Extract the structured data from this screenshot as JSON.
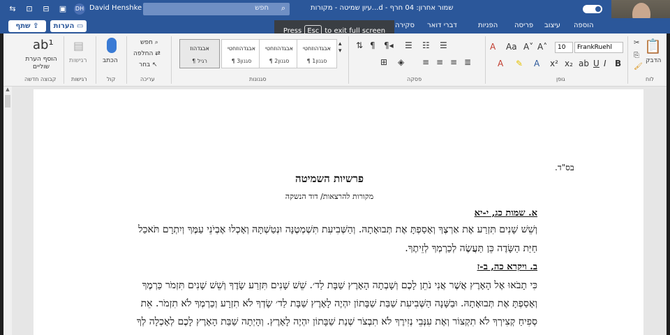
{
  "titlebar": {
    "user_initials": "DH",
    "user_name": "David Henshke",
    "search_placeholder": "חפש",
    "doc_title": "עיון שמיטה - מקורות...d - שמור אחרון: 04 חרף",
    "icon_labels": [
      "⇆",
      "⊡",
      "⊟",
      "▣"
    ]
  },
  "fullscreen": {
    "press": "Press",
    "esc": "Esc",
    "rest": "to exit full screen"
  },
  "tabs": [
    "הוספה",
    "עיצוב",
    "פריסה",
    "הפניות",
    "דברי דואר",
    "סקירה"
  ],
  "share_label": "שתף",
  "comments_label": "הערות",
  "ribbon": {
    "clipboard": {
      "paste": "הדבק",
      "group": "לוח"
    },
    "font": {
      "size": "10",
      "name": "FrankRuehl",
      "group": "גופן"
    },
    "paragraph": {
      "group": "פסקה"
    },
    "styles": {
      "group": "סגנונות",
      "items": [
        {
          "name": "אבגדהוז",
          "caption": "¶ רגיל"
        },
        {
          "name": "אבגדהוזחטי",
          "caption": "¶ סגנון3"
        },
        {
          "name": "אבגדהוזחטי",
          "caption": "¶ סגנון2"
        },
        {
          "name": "אבגדהוזחטי",
          "caption": "¶ סגנון1"
        }
      ]
    },
    "editing": {
      "find": "חפש",
      "replace": "החלפה",
      "select": "בחר",
      "group": "עריכה"
    },
    "voice": {
      "dictate": "הכתב",
      "group": "קול"
    },
    "sensitivity": {
      "label": "רגישות",
      "group": "רגישות"
    },
    "comments_group": {
      "label": "הוסף הערת שוליים",
      "group": "קבוצה חדשה"
    }
  },
  "document": {
    "page_header": "בס\"ד.",
    "title": "פרשיות השמיטה",
    "subtitle": "מקורות להרצאות/ דוד הנשקה",
    "sections": [
      {
        "head": "א. שמות כג, י-יא"
      },
      {
        "head": "ב. ויקרא כה, ב-ז"
      }
    ],
    "lines": [
      "וְשֵׁשׁ שָׁנִים תִּזְרַע אֶת אַרְצֶךָ וְאָסַפְתָּ אֶת תְּבוּאָתָהּ. וְהַשְּׁבִיעִת תִּשְׁמְטֶנָּה וּנְטַשְׁתָּהּ וְאָכְלוּ אֶבְיֹנֵי עַמֶּךָ וְיִתְרָם תֹּאכַל",
      "חַיַּת הַשָּׂדֶה כֵּן תַּעֲשֶׂה לְכַרְמְךָ לְזֵיתֶךָ.",
      "כִּי תָבֹאוּ אֶל הָאָרֶץ אֲשֶׁר אֲנִי נֹתֵן לָכֶם וְשָׁבְתָה הָאָרֶץ שַׁבָּת לַד׳. שֵׁשׁ שָׁנִים תִּזְרַע שָׂדֶךָ וְשֵׁשׁ שָׁנִים תִּזְמֹר כַּרְמֶךָ",
      "וְאָסַפְתָּ אֶת תְּבוּאָתָהּ. וּבַשָּׁנָה הַשְּׁבִיעִת שַׁבַּת שַׁבָּתוֹן יִהְיֶה לָאָרֶץ שַׁבָּת לַד׳ שָׂדְךָ לֹא תִזְרָע וְכַרְמְךָ לֹא תִזְמֹר. אֵת",
      "סְפִיחַ קְצִירְךָ לֹא תִקְצוֹר וְאֶת עִנְּבֵי נְזִירֶךָ לֹא תִבְצֹר שְׁנַת שַׁבָּתוֹן יִהְיֶה לָאָרֶץ. וְהָיְתָה שַׁבַּת הָאָרֶץ לָכֶם לְאָכְלָה לְךָ"
    ]
  }
}
